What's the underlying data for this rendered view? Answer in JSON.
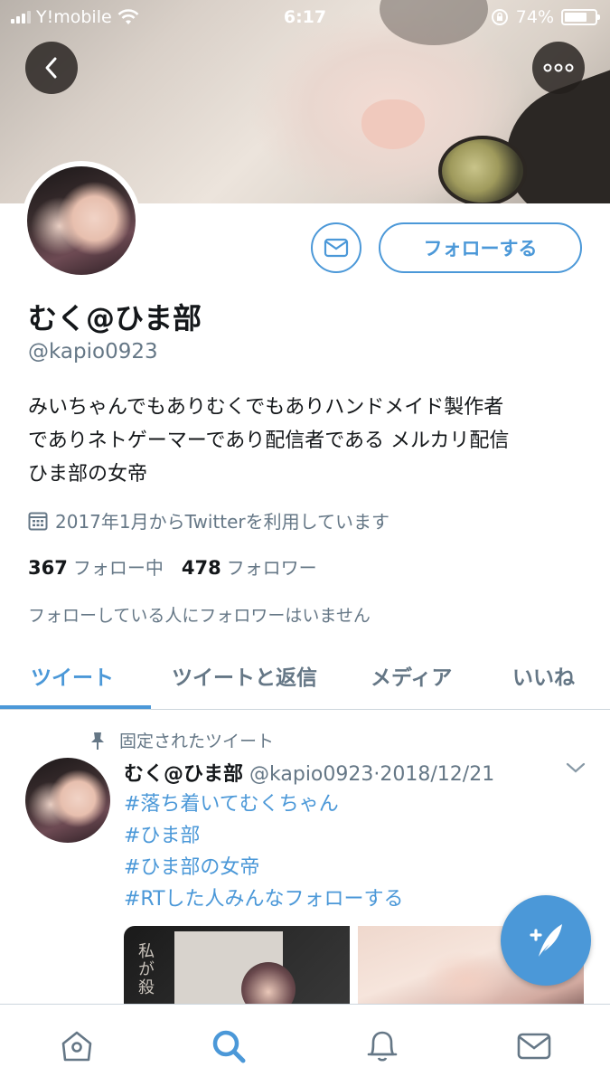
{
  "status_bar": {
    "carrier": "Y!mobile",
    "time": "6:17",
    "battery": "74%",
    "battery_level": 0.74
  },
  "profile": {
    "name": "むく@ひま部",
    "handle": "@kapio0923",
    "bio_lines": [
      "みいちゃんでもありむくでもありハンドメイド製作者",
      "でありネトゲーマーであり配信者である メルカリ配信",
      "ひま部の女帝"
    ],
    "joined": "2017年1月からTwitterを利用しています",
    "following_count": "367",
    "following_label": "フォロー中",
    "followers_count": "478",
    "followers_label": "フォロワー",
    "no_followers_known": "フォローしている人にフォロワーはいません",
    "follow_button": "フォローする"
  },
  "tabs": [
    "ツイート",
    "ツイートと返信",
    "メディア",
    "いいね"
  ],
  "pinned_tweet": {
    "pinned_label": "固定されたツイート",
    "author_name": "むく@ひま部",
    "author_handle": "@kapio0923",
    "date": "2018/12/21",
    "hashtags": [
      "#落ち着いてむくちゃん",
      "#ひま部",
      "#ひま部の女帝",
      "#RTした人みんなフォローする"
    ],
    "media_text": "私が殺"
  },
  "bottom_nav": [
    "home-icon",
    "search-icon",
    "notifications-icon",
    "messages-icon"
  ],
  "colors": {
    "accent": "#4b98d8",
    "secondary_text": "#657786",
    "primary_text": "#14171a"
  }
}
